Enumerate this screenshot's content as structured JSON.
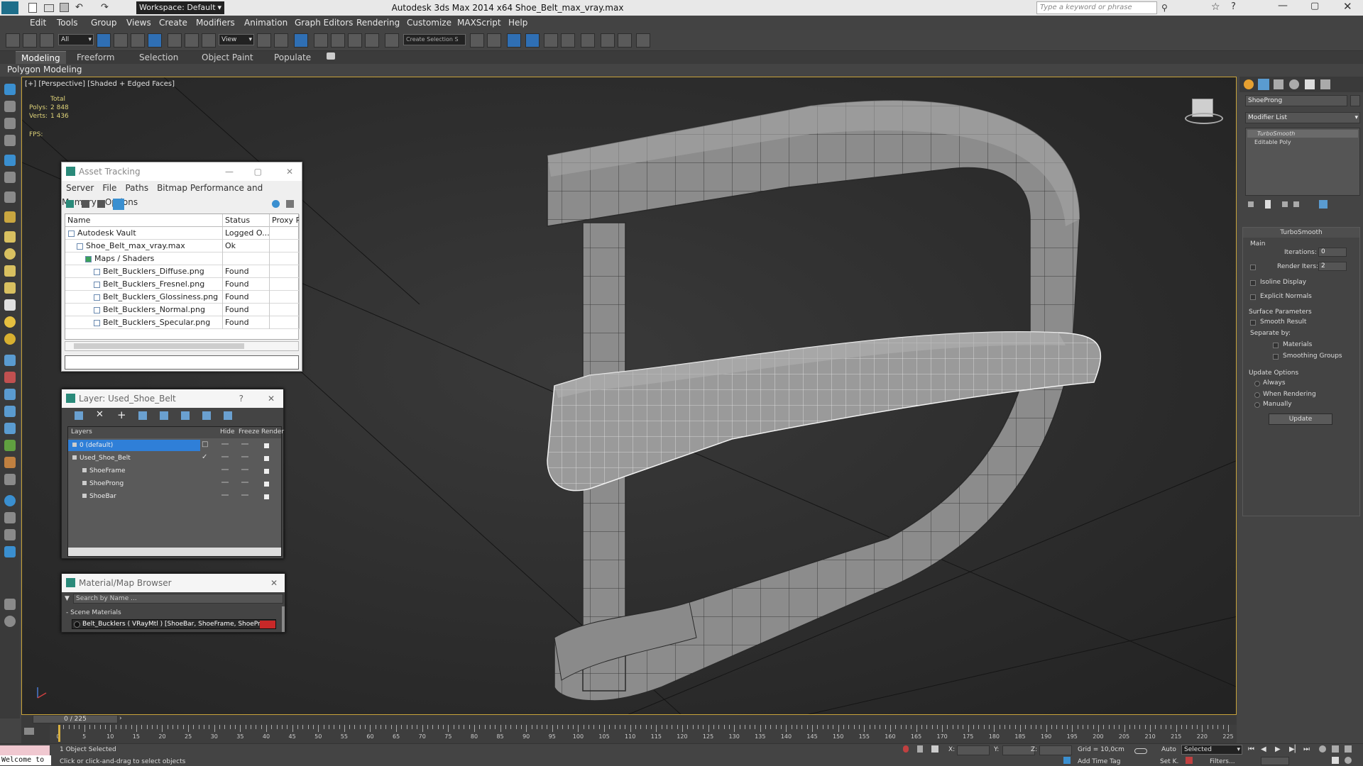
{
  "app": {
    "workspace_label": "Workspace: Default",
    "title": "Autodesk 3ds Max  2014 x64     Shoe_Belt_max_vray.max",
    "search_placeholder": "Type a keyword or phrase"
  },
  "menu": [
    "Edit",
    "Tools",
    "Group",
    "Views",
    "Create",
    "Modifiers",
    "Animation",
    "Graph Editors",
    "Rendering",
    "Customize",
    "MAXScript",
    "Help"
  ],
  "toolbar": {
    "selection_filter": "All",
    "ref_coord": "View",
    "named_selection": "Create Selection S"
  },
  "ribbon": {
    "tabs": [
      "Modeling",
      "Freeform",
      "Selection",
      "Object Paint",
      "Populate"
    ],
    "active": "Modeling",
    "subpanel": "Polygon Modeling"
  },
  "viewport": {
    "label": "[+] [Perspective] [Shaded + Edged Faces]",
    "stats": {
      "total": "Total",
      "polys_label": "Polys:",
      "polys": "2 848",
      "verts_label": "Verts:",
      "verts": "1 436",
      "fps_label": "FPS:"
    }
  },
  "asset_tracking": {
    "title": "Asset Tracking",
    "menu": [
      "Server",
      "File",
      "Paths",
      "Bitmap Performance and Memory",
      "Options"
    ],
    "columns": [
      "Name",
      "Status",
      "Proxy Re"
    ],
    "rows": [
      {
        "name": "Autodesk Vault",
        "status": "Logged O...",
        "indent": 0
      },
      {
        "name": "Shoe_Belt_max_vray.max",
        "status": "Ok",
        "indent": 1
      },
      {
        "name": "Maps / Shaders",
        "status": "",
        "indent": 2
      },
      {
        "name": "Belt_Bucklers_Diffuse.png",
        "status": "Found",
        "indent": 3
      },
      {
        "name": "Belt_Bucklers_Fresnel.png",
        "status": "Found",
        "indent": 3
      },
      {
        "name": "Belt_Bucklers_Glossiness.png",
        "status": "Found",
        "indent": 3
      },
      {
        "name": "Belt_Bucklers_Normal.png",
        "status": "Found",
        "indent": 3
      },
      {
        "name": "Belt_Bucklers_Specular.png",
        "status": "Found",
        "indent": 3
      }
    ]
  },
  "layer_panel": {
    "title": "Layer: Used_Shoe_Belt",
    "help": "?",
    "columns": [
      "Layers",
      "Hide",
      "Freeze",
      "Render"
    ],
    "rows": [
      {
        "name": "0 (default)",
        "indent": 0,
        "selected": true
      },
      {
        "name": "Used_Shoe_Belt",
        "indent": 0,
        "selected": false
      },
      {
        "name": "ShoeFrame",
        "indent": 1,
        "selected": false
      },
      {
        "name": "ShoeProng",
        "indent": 1,
        "selected": false
      },
      {
        "name": "ShoeBar",
        "indent": 1,
        "selected": false
      }
    ]
  },
  "material_browser": {
    "title": "Material/Map Browser",
    "search_placeholder": "Search by Name ...",
    "group": "- Scene Materials",
    "item": "Belt_Bucklers  ( VRayMtl )  [ShoeBar, ShoeFrame, ShoeProng]"
  },
  "command_panel": {
    "object_name": "ShoeProng",
    "modifier_list": "Modifier List",
    "stack": [
      "TurboSmooth",
      "Editable Poly"
    ],
    "rollout": "TurboSmooth",
    "main": "Main",
    "iterations_label": "Iterations:",
    "iterations": "0",
    "render_iters_label": "Render Iters:",
    "render_iters": "2",
    "isoline": "Isoline Display",
    "explicit_normals": "Explicit Normals",
    "surface_params": "Surface Parameters",
    "smooth_result": "Smooth Result",
    "separate_by": "Separate by:",
    "materials": "Materials",
    "smoothing_groups": "Smoothing Groups",
    "update_options": "Update Options",
    "always": "Always",
    "when_rendering": "When Rendering",
    "manually": "Manually",
    "update_button": "Update"
  },
  "timeline": {
    "frame_label": "0 / 225",
    "ticks": [
      "0",
      "5",
      "10",
      "15",
      "20",
      "25",
      "30",
      "35",
      "40",
      "45",
      "50",
      "55",
      "60",
      "65",
      "70",
      "75",
      "80",
      "85",
      "90",
      "95",
      "100",
      "105",
      "110",
      "115",
      "120",
      "125",
      "130",
      "135",
      "140",
      "145",
      "150",
      "155",
      "160",
      "165",
      "170",
      "175",
      "180",
      "185",
      "190",
      "195",
      "200",
      "205",
      "210",
      "215",
      "220",
      "225"
    ]
  },
  "status": {
    "maxscript": "Welcome to",
    "selected": "1 Object Selected",
    "prompt": "Click or click-and-drag to select objects",
    "x_label": "X:",
    "y_label": "Y:",
    "z_label": "Z:",
    "grid": "Grid = 10,0cm",
    "add_time_tag": "Add Time Tag",
    "auto": "Auto",
    "selected_dropdown": "Selected",
    "setk": "Set K.",
    "filters": "Filters..."
  }
}
